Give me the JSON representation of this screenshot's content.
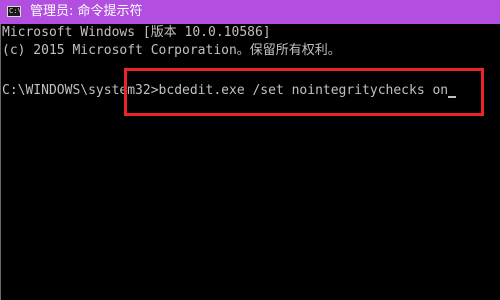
{
  "window": {
    "title": "管理员: 命令提示符",
    "icon": "cmd-icon",
    "title_color": "#b24fe0"
  },
  "console": {
    "lines": [
      "Microsoft Windows [版本 10.0.10586]",
      "(c) 2015 Microsoft Corporation。保留所有权利。",
      ""
    ],
    "prompt": "C:\\WINDOWS\\system32>",
    "command": "bcdedit.exe /set nointegritychecks on",
    "text_color": "#c0c0c0",
    "background": "#000000"
  },
  "annotation": {
    "highlight_color": "#e8262a"
  }
}
